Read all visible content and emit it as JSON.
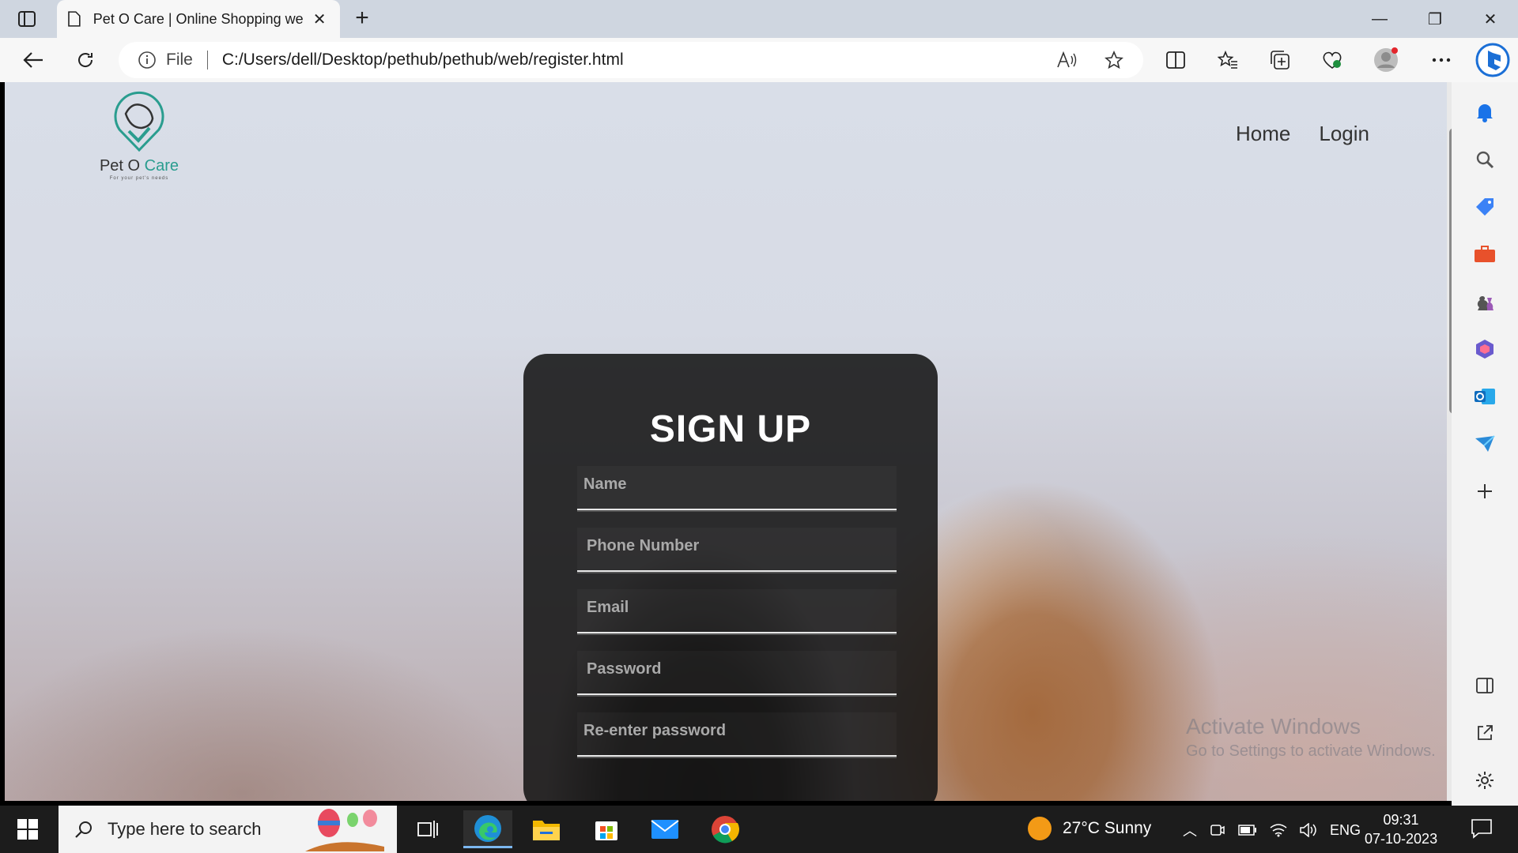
{
  "browser": {
    "tab_title": "Pet O Care | Online Shopping we",
    "address_scheme": "File",
    "address_url": "C:/Users/dell/Desktop/pethub/pethub/web/register.html"
  },
  "site": {
    "logo_name_1": "Pet O ",
    "logo_name_2": "Care",
    "logo_tagline": "For your pet's needs",
    "nav": [
      "Home",
      "Login"
    ]
  },
  "form": {
    "title": "SIGN UP",
    "fields": [
      {
        "placeholder": "Name"
      },
      {
        "placeholder": "Phone Number"
      },
      {
        "placeholder": "Email"
      },
      {
        "placeholder": "Password"
      },
      {
        "placeholder": "Re-enter password"
      }
    ]
  },
  "watermark": {
    "line1": "Activate Windows",
    "line2": "Go to Settings to activate Windows."
  },
  "taskbar": {
    "search_placeholder": "Type here to search",
    "weather": "27°C  Sunny",
    "language": "ENG",
    "time": "09:31",
    "date": "07-10-2023"
  },
  "colors": {
    "brand_teal": "#2a9d8f",
    "card_bg": "#141414"
  }
}
